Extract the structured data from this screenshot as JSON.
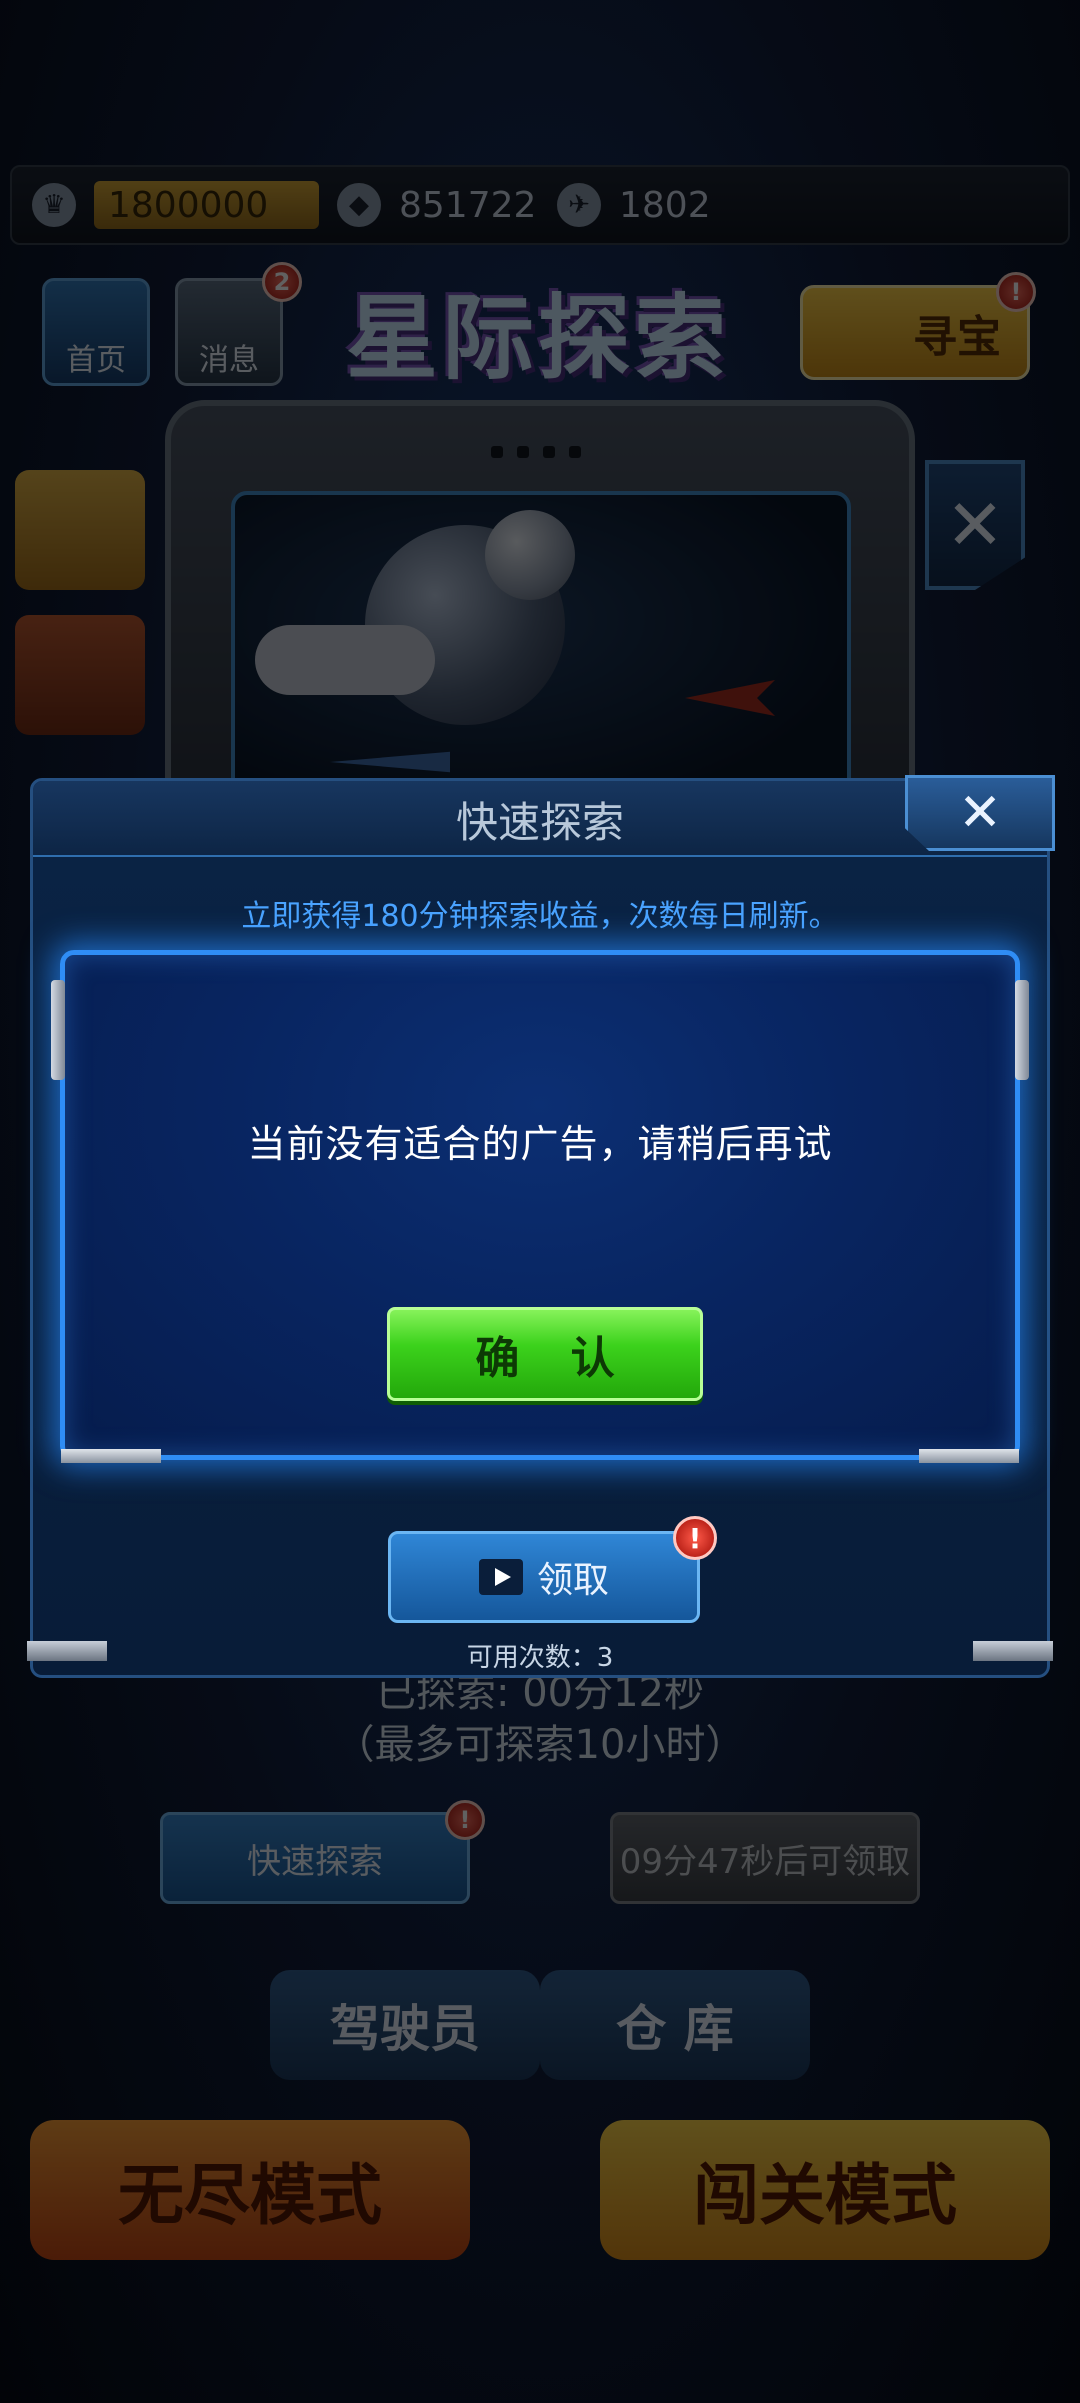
{
  "background": {
    "topbar": {
      "gold_value": "1800000",
      "crystal_value": "851722",
      "ship_value": "1802"
    },
    "side_buttons": [
      {
        "label": "首页"
      },
      {
        "label": "消息",
        "badge": "2"
      }
    ],
    "game_title": "星际探索",
    "treasure_label": "寻宝",
    "status_explored": "已探索: 00分12秒",
    "status_max": "（最多可探索10小时）",
    "quick_button": "快速探索",
    "collect_button": "09分47秒后可领取",
    "nav_left": "驾驶员",
    "nav_right": "仓 库",
    "mode_left": "无尽模式",
    "mode_right": "闯关模式"
  },
  "panel": {
    "title": "快速探索",
    "description": "立即获得180分钟探索收益，次数每日刷新。",
    "claim_label": "领取",
    "claim_badge": "!",
    "uses_label": "可用次数：3"
  },
  "dialog": {
    "message": "当前没有适合的广告，请稍后再试",
    "confirm_label": "确 认"
  }
}
